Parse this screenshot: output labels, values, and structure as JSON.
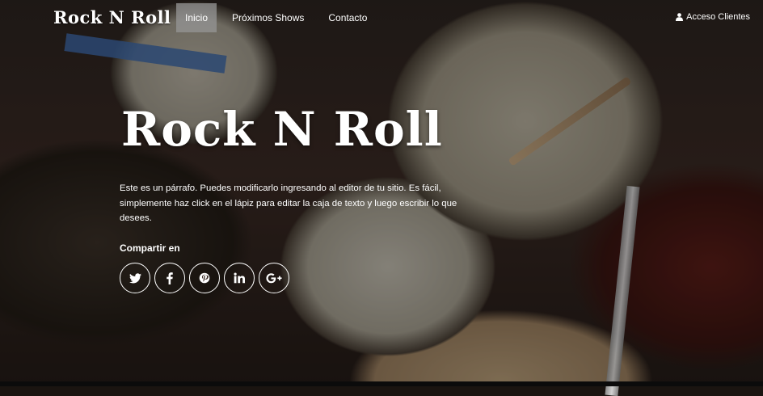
{
  "nav": {
    "brand": "Rock N Roll",
    "items": [
      {
        "label": "Inicio",
        "active": true
      },
      {
        "label": "Próximos Shows",
        "active": false
      },
      {
        "label": "Contacto",
        "active": false
      }
    ],
    "client_login": "Acceso Clientes"
  },
  "hero": {
    "title": "Rock N Roll",
    "paragraph": "Este es un párrafo. Puedes modificarlo ingresando al editor de tu sitio. Es fácil, simplemente haz click en el lápiz para editar la caja de texto y luego escribir lo que desees.",
    "share_label": "Compartir en"
  },
  "social": [
    {
      "icon": "twitter-icon"
    },
    {
      "icon": "facebook-icon"
    },
    {
      "icon": "pinterest-icon"
    },
    {
      "icon": "linkedin-icon"
    },
    {
      "icon": "google-plus-icon"
    }
  ],
  "colors": {
    "active_nav_bg": "#969696",
    "text": "#ffffff"
  }
}
